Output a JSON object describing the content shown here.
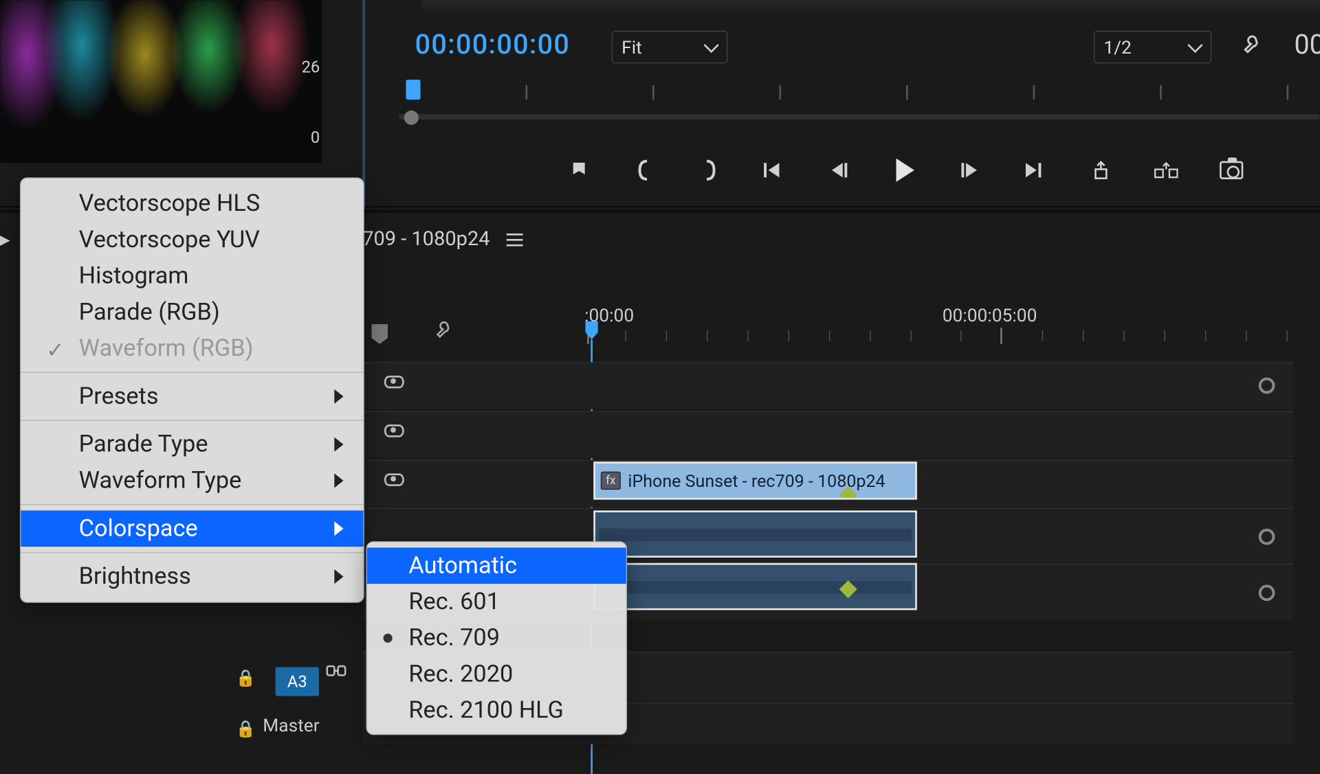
{
  "scope": {
    "scale26": "26",
    "scale0": "0"
  },
  "program": {
    "timecode": "00:00:00:00",
    "fit_label": "Fit",
    "resolution_label": "1/2",
    "tc_right": "00"
  },
  "sequence": {
    "name_suffix": "709 - 1080p24"
  },
  "timeline": {
    "time1": ":00:00",
    "time2": "00:00:05:00",
    "clip_video_label": "iPhone Sunset - rec709 - 1080p24",
    "fx_label": "fx",
    "a3_label": "A3",
    "master_label": "Master"
  },
  "menu": {
    "group1": [
      "Vectorscope HLS",
      "Vectorscope YUV",
      "Histogram",
      "Parade (RGB)",
      "Waveform (RGB)"
    ],
    "presets": "Presets",
    "parade_type": "Parade Type",
    "waveform_type": "Waveform Type",
    "colorspace": "Colorspace",
    "brightness": "Brightness",
    "submenu": {
      "automatic": "Automatic",
      "rec601": "Rec. 601",
      "rec709": "Rec. 709",
      "rec2020": "Rec. 2020",
      "rec2100": "Rec. 2100 HLG"
    }
  }
}
